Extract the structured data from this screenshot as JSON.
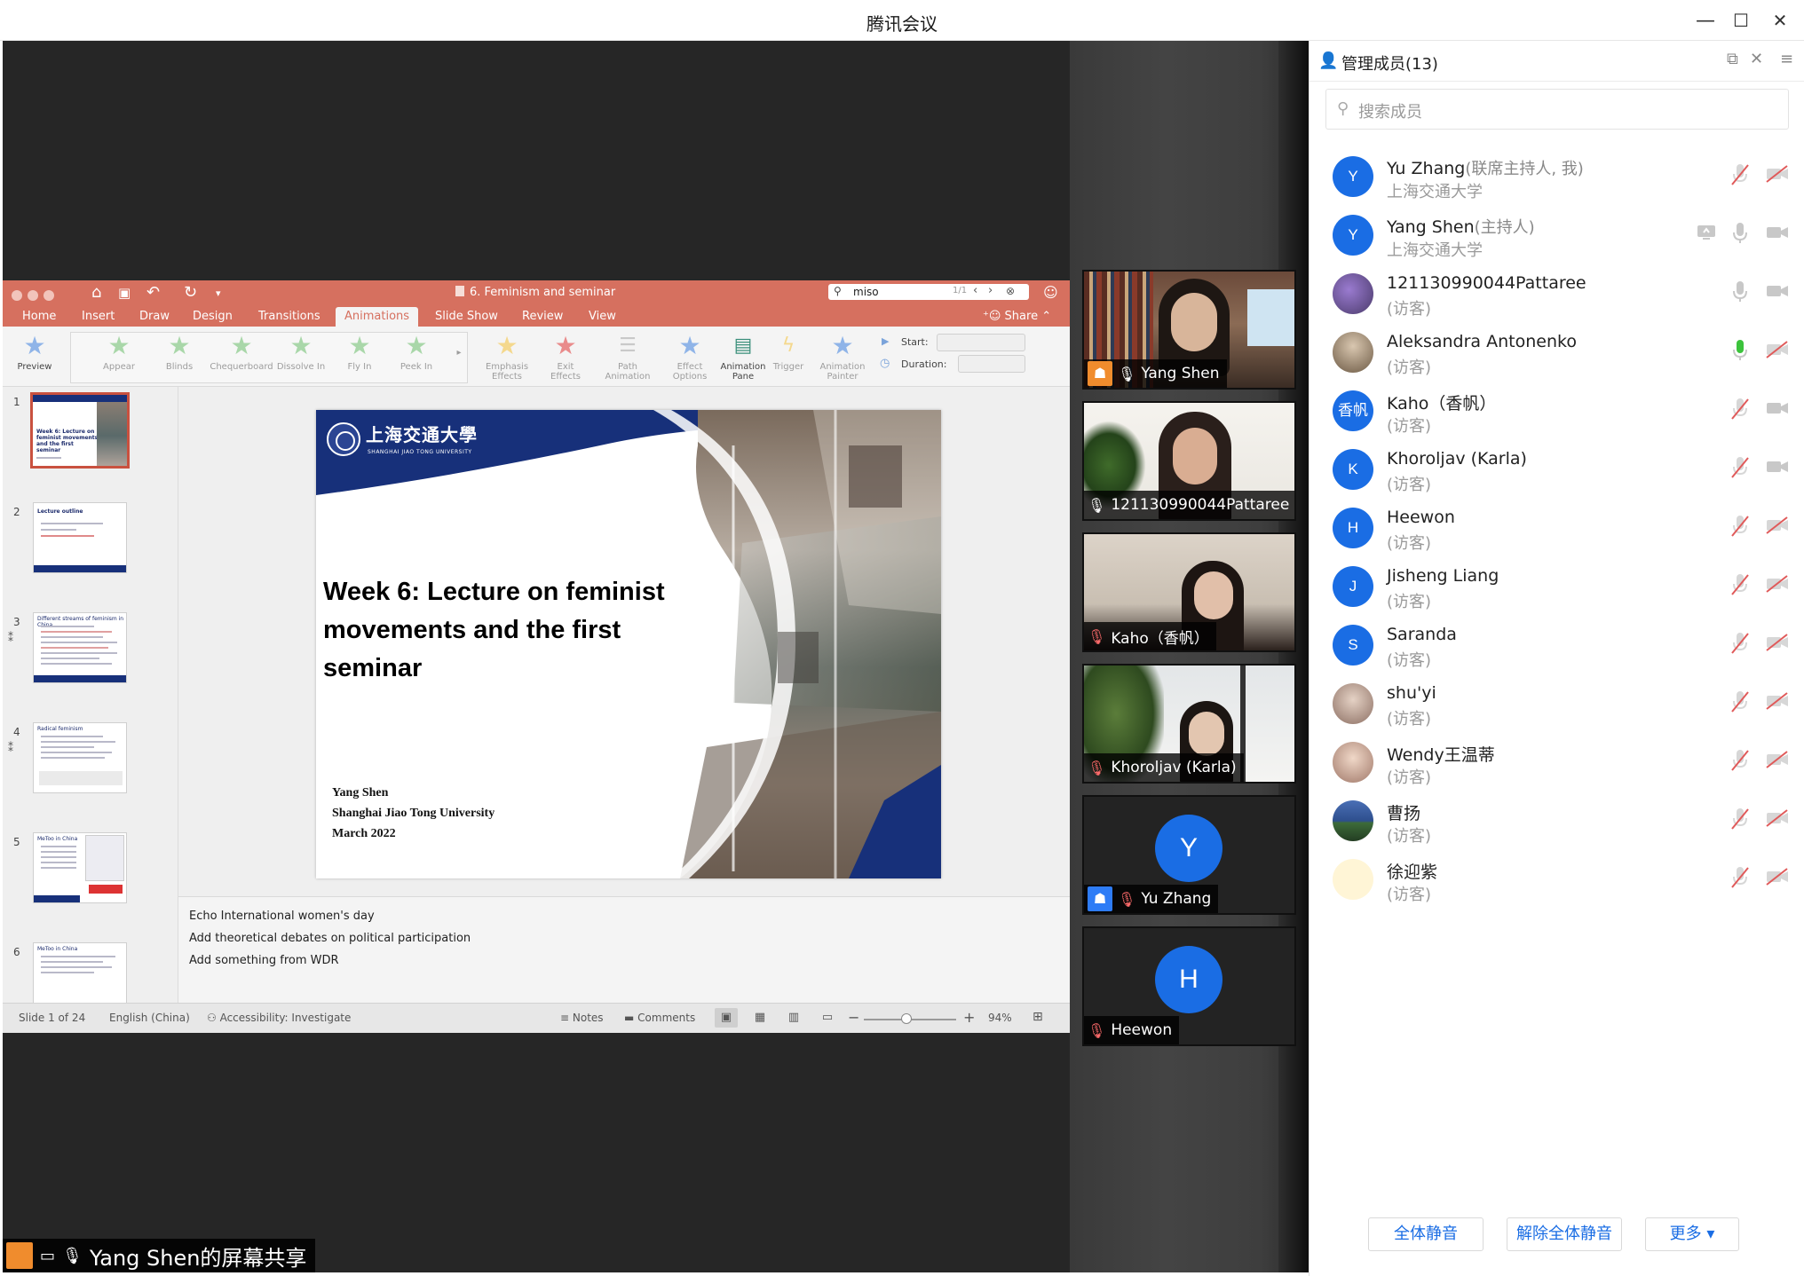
{
  "window": {
    "title": "腾讯会议",
    "minimize_glyph": "—",
    "maximize_glyph": "☐",
    "close_glyph": "✕"
  },
  "ppt": {
    "doc_title": "6. Feminism and seminar",
    "search_query": "miso",
    "search_count": "1/1",
    "tabs": [
      "Home",
      "Insert",
      "Draw",
      "Design",
      "Transitions",
      "Animations",
      "Slide Show",
      "Review",
      "View"
    ],
    "active_tab": "Animations",
    "share_label": "Share",
    "ribbon": {
      "preview": "Preview",
      "effects": [
        "Appear",
        "Blinds",
        "Chequerboard",
        "Dissolve In",
        "Fly In",
        "Peek In"
      ],
      "emphasis": "Emphasis Effects",
      "exit": "Exit Effects",
      "path": "Path Animation",
      "effect_options": "Effect Options",
      "animation_pane": "Animation Pane",
      "trigger": "Trigger",
      "animation_painter": "Animation Painter",
      "start_label": "Start:",
      "duration_label": "Duration:"
    },
    "thumbnails": [
      {
        "num": "1",
        "title": "Week 6: Lecture on feminist movements and the first seminar"
      },
      {
        "num": "2",
        "title": "Lecture outline"
      },
      {
        "num": "3",
        "title": "Different streams of feminism in China"
      },
      {
        "num": "4",
        "title": "Radical feminism"
      },
      {
        "num": "5",
        "title": "MeToo in China"
      },
      {
        "num": "6",
        "title": "MeToo in China"
      }
    ],
    "slide": {
      "univ_cn": "上海交通大學",
      "univ_en": "SHANGHAI JIAO TONG UNIVERSITY",
      "title_line1": "Week 6: Lecture on feminist",
      "title_line2": "movements and the first seminar",
      "author": "Yang Shen",
      "affiliation": "Shanghai Jiao Tong University",
      "date": "March 2022"
    },
    "notes": [
      "Echo International women's day",
      "Add theoretical debates on political participation",
      "Add something from WDR"
    ],
    "status": {
      "slide_info": "Slide 1 of 24",
      "language": "English (China)",
      "accessibility": "Accessibility: Investigate",
      "notes": "Notes",
      "comments": "Comments",
      "zoom": "94%"
    }
  },
  "video_tiles": [
    {
      "name": "Yang Shen",
      "muted": false,
      "badge": "orange"
    },
    {
      "name": "121130990044Pattaree",
      "muted": false,
      "badge": "none"
    },
    {
      "name": "Kaho（香帆）",
      "muted": true,
      "badge": "none"
    },
    {
      "name": "Khoroljav (Karla)",
      "muted": true,
      "badge": "none"
    },
    {
      "name": "Yu Zhang",
      "muted": true,
      "badge": "blue",
      "avatar_letter": "Y"
    },
    {
      "name": "Heewon",
      "muted": true,
      "badge": "none",
      "avatar_letter": "H"
    }
  ],
  "screen_share_label": "Yang Shen的屏幕共享",
  "panel": {
    "title": "管理成员(13)",
    "search_placeholder": "搜索成员",
    "members": [
      {
        "avatar": "Y",
        "name": "Yu Zhang",
        "role": "(联席主持人, 我)",
        "sub": "上海交通大学",
        "mic": "muted",
        "cam": "off"
      },
      {
        "avatar": "Y",
        "name": "Yang Shen",
        "role": "(主持人)",
        "sub": "上海交通大学",
        "mic": "on",
        "cam": "on",
        "sharing": true
      },
      {
        "avatar": "",
        "name": "121130990044Pattaree",
        "role": "",
        "sub": "(访客)",
        "mic": "on",
        "cam": "on"
      },
      {
        "avatar": "",
        "name": "Aleksandra Antonenko",
        "role": "",
        "sub": "(访客)",
        "mic": "speaking",
        "cam": "off"
      },
      {
        "avatar": "香帆",
        "name": "Kaho（香帆）",
        "role": "",
        "sub": "(访客)",
        "mic": "muted",
        "cam": "on"
      },
      {
        "avatar": "K",
        "name": "Khoroljav (Karla)",
        "role": "",
        "sub": "(访客)",
        "mic": "muted",
        "cam": "on"
      },
      {
        "avatar": "H",
        "name": "Heewon",
        "role": "",
        "sub": "(访客)",
        "mic": "muted",
        "cam": "off"
      },
      {
        "avatar": "J",
        "name": "Jisheng Liang",
        "role": "",
        "sub": "(访客)",
        "mic": "muted",
        "cam": "off"
      },
      {
        "avatar": "S",
        "name": "Saranda",
        "role": "",
        "sub": "(访客)",
        "mic": "muted",
        "cam": "off"
      },
      {
        "avatar": "",
        "name": "shu'yi",
        "role": "",
        "sub": "(访客)",
        "mic": "muted",
        "cam": "off"
      },
      {
        "avatar": "",
        "name": "Wendy王温蒂",
        "role": "",
        "sub": "(访客)",
        "mic": "muted",
        "cam": "off"
      },
      {
        "avatar": "",
        "name": "曹扬",
        "role": "",
        "sub": "(访客)",
        "mic": "muted",
        "cam": "off"
      },
      {
        "avatar": "",
        "name": "徐迎紫",
        "role": "",
        "sub": "(访客)",
        "mic": "muted",
        "cam": "off"
      }
    ],
    "buttons": {
      "mute_all": "全体静音",
      "unmute_all": "解除全体静音",
      "more": "更多 ▾"
    }
  },
  "colors": {
    "ppt_accent": "#d6705f",
    "sjtu_blue": "#17307a",
    "tencent_blue": "#1a6de4",
    "muted_red": "#e05a5a",
    "speaking_green": "#3cc33c"
  }
}
